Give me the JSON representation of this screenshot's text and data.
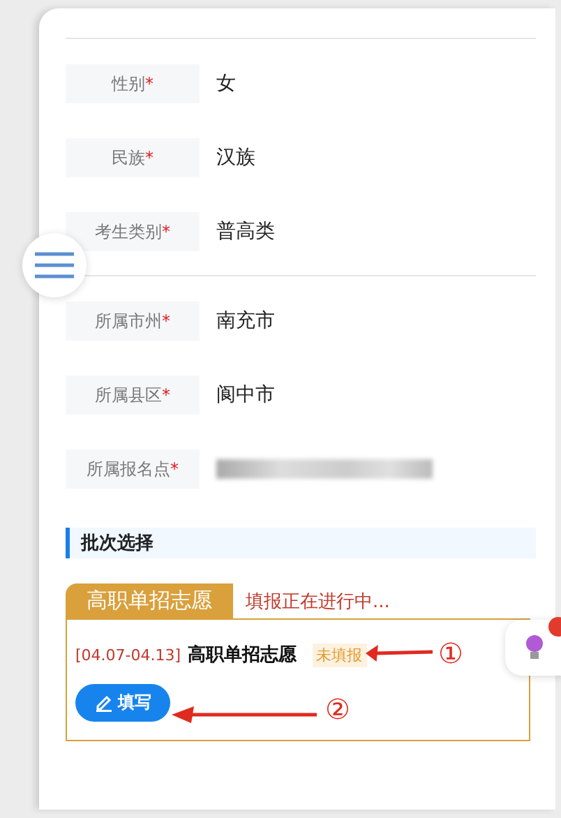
{
  "fields_group_1": [
    {
      "label": "性别",
      "mark": "*",
      "value": "女"
    },
    {
      "label": "民族",
      "mark": "*",
      "value": "汉族"
    },
    {
      "label": "考生类别",
      "mark": "*",
      "value": "普高类"
    }
  ],
  "fields_group_2": [
    {
      "label": "所属市州",
      "mark": "*",
      "value": "南充市"
    },
    {
      "label": "所属县区",
      "mark": "*",
      "value": "阆中市"
    },
    {
      "label": "所属报名点",
      "mark": "*",
      "redacted": true
    }
  ],
  "section": {
    "title": "批次选择"
  },
  "batch": {
    "tab": "高职单招志愿",
    "status": "填报正在进行中...",
    "date": "[04.07-04.13]",
    "name": "高职单招志愿",
    "state": "未填报",
    "button": "填写"
  },
  "annotations": [
    {
      "mark": "①"
    },
    {
      "mark": "②"
    }
  ]
}
